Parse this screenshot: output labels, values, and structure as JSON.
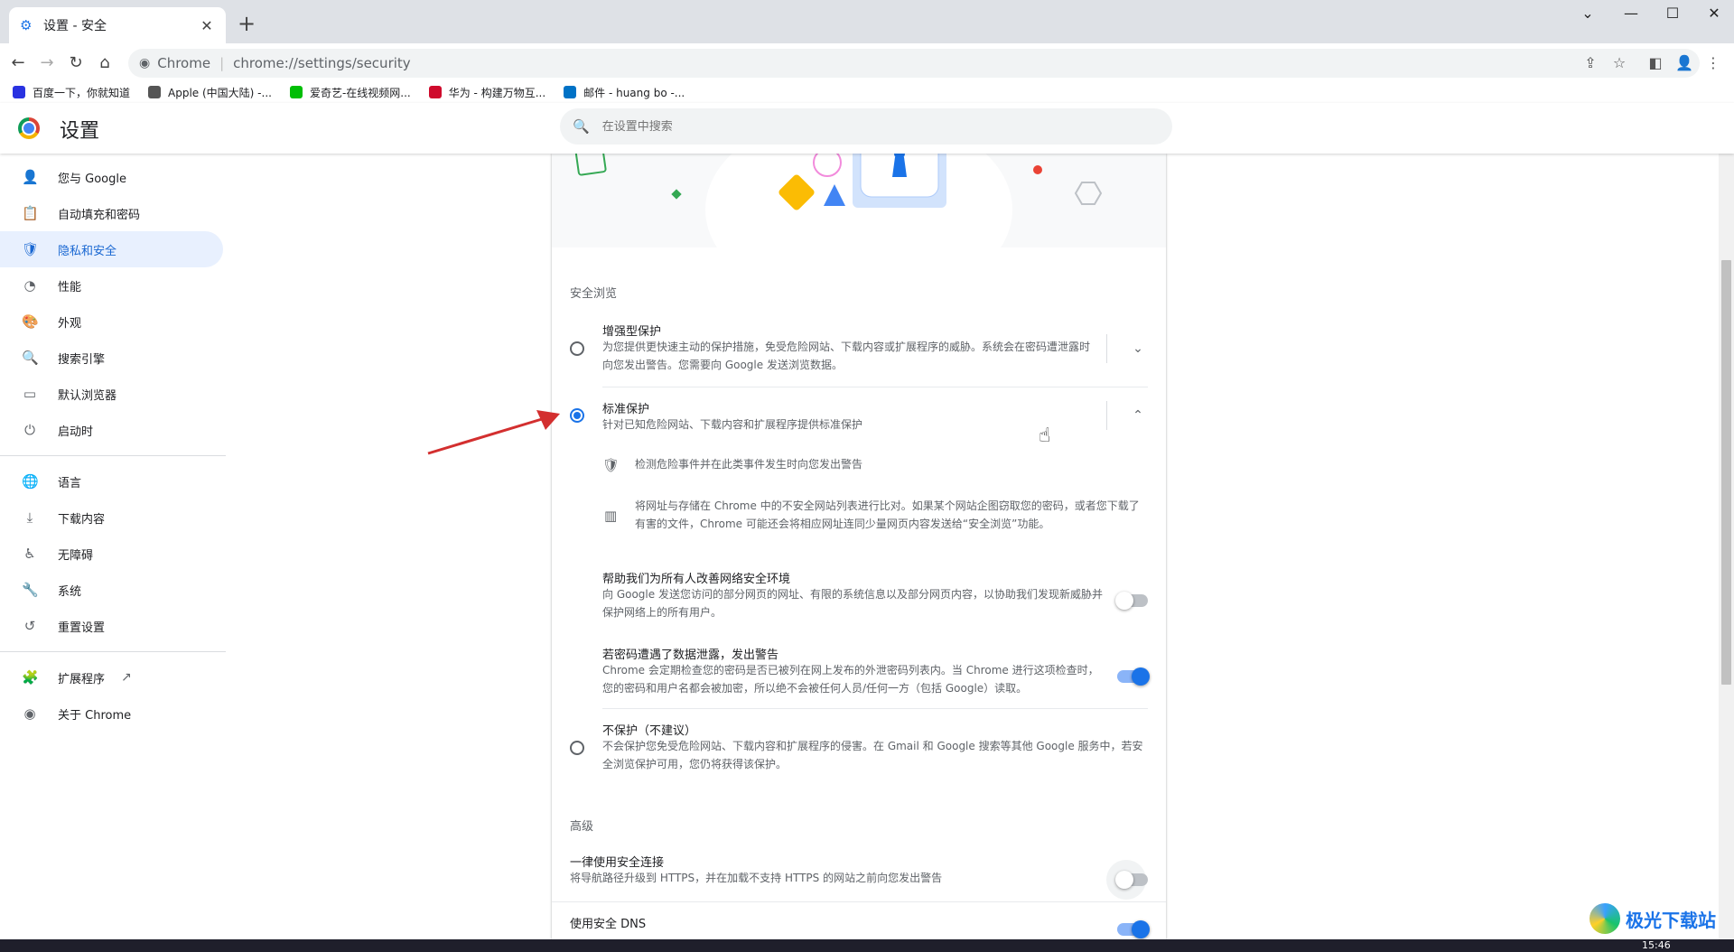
{
  "tab": {
    "title": "设置 - 安全",
    "close": "✕",
    "favicon": "gear-icon"
  },
  "toolbar": {
    "site": "Chrome",
    "url": "chrome://settings/security"
  },
  "bookmarks": [
    {
      "label": "百度一下，你就知道",
      "color": "#2932e1"
    },
    {
      "label": "Apple (中国大陆) -...",
      "color": "#555555"
    },
    {
      "label": "爱奇艺-在线视频网...",
      "color": "#00be06"
    },
    {
      "label": "华为 - 构建万物互...",
      "color": "#cf0a2c"
    },
    {
      "label": "邮件 - huang bo -...",
      "color": "#0072c6"
    }
  ],
  "header": {
    "title": "设置",
    "search_placeholder": "在设置中搜索"
  },
  "sidebar": {
    "items": [
      {
        "label": "您与 Google",
        "icon": "person-icon",
        "glyph": "👤"
      },
      {
        "label": "自动填充和密码",
        "icon": "clipboard-icon",
        "glyph": "📋"
      },
      {
        "label": "隐私和安全",
        "icon": "shield-icon",
        "glyph": "🛡"
      },
      {
        "label": "性能",
        "icon": "speedometer-icon",
        "glyph": "◔"
      },
      {
        "label": "外观",
        "icon": "palette-icon",
        "glyph": "🎨"
      },
      {
        "label": "搜索引擎",
        "icon": "search-icon",
        "glyph": "🔍"
      },
      {
        "label": "默认浏览器",
        "icon": "browser-icon",
        "glyph": "▭"
      },
      {
        "label": "启动时",
        "icon": "power-icon",
        "glyph": "⏻"
      }
    ],
    "items2": [
      {
        "label": "语言",
        "icon": "globe-icon",
        "glyph": "🌐"
      },
      {
        "label": "下载内容",
        "icon": "download-icon",
        "glyph": "⤓"
      },
      {
        "label": "无障碍",
        "icon": "accessibility-icon",
        "glyph": "♿"
      },
      {
        "label": "系统",
        "icon": "wrench-icon",
        "glyph": "🔧"
      },
      {
        "label": "重置设置",
        "icon": "history-icon",
        "glyph": "↺"
      }
    ],
    "items3": [
      {
        "label": "扩展程序",
        "icon": "puzzle-icon",
        "glyph": "🧩"
      },
      {
        "label": "关于 Chrome",
        "icon": "chrome-icon",
        "glyph": "◉"
      }
    ]
  },
  "main": {
    "safe_browsing_title": "安全浏览",
    "enhanced": {
      "title": "增强型保护",
      "desc": "为您提供更快速主动的保护措施，免受危险网站、下载内容或扩展程序的威胁。系统会在密码遭泄露时向您发出警告。您需要向 Google 发送浏览数据。",
      "selected": false
    },
    "standard": {
      "title": "标准保护",
      "desc": "针对已知危险网站、下载内容和扩展程序提供标准保护",
      "selected": true,
      "feature1": "检测危险事件并在此类事件发生时向您发出警告",
      "feature2": "将网址与存储在 Chrome 中的不安全网站列表进行比对。如果某个网站企图窃取您的密码，或者您下载了有害的文件，Chrome 可能还会将相应网址连同少量网页内容发送给“安全浏览”功能。"
    },
    "help_improve": {
      "title": "帮助我们为所有人改善网络安全环境",
      "desc": "向 Google 发送您访问的部分网页的网址、有限的系统信息以及部分网页内容，以协助我们发现新威胁并保护网络上的所有用户。",
      "enabled": false
    },
    "password_alert": {
      "title": "若密码遭遇了数据泄露，发出警告",
      "desc": "Chrome 会定期检查您的密码是否已被列在网上发布的外泄密码列表内。当 Chrome 进行这项检查时，您的密码和用户名都会被加密，所以绝不会被任何人员/任何一方（包括 Google）读取。",
      "enabled": true
    },
    "no_protection": {
      "title": "不保护（不建议）",
      "desc": "不会保护您免受危险网站、下载内容和扩展程序的侵害。在 Gmail 和 Google 搜索等其他 Google 服务中，若安全浏览保护可用，您仍将获得该保护。",
      "selected": false
    },
    "advanced_title": "高级",
    "https_only": {
      "title": "一律使用安全连接",
      "desc": "将导航路径升级到 HTTPS，并在加载不支持 HTTPS 的网站之前向您发出警告",
      "enabled": false
    },
    "secure_dns": {
      "title": "使用安全 DNS",
      "enabled": true
    }
  },
  "taskbar": {
    "time": "15:46"
  },
  "watermark": "极光下载站",
  "colors": {
    "accent": "#1a73e8",
    "active_bg": "#e8f0fe",
    "arrow": "#d32f2f"
  }
}
